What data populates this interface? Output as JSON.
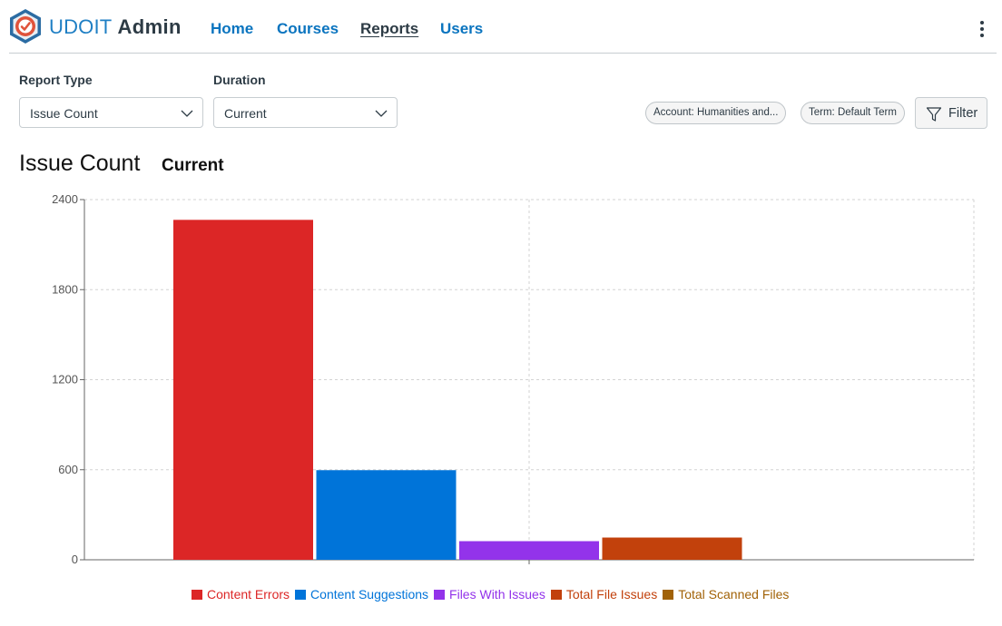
{
  "header": {
    "brand_name": "UDOIT",
    "brand_suffix": "Admin",
    "nav": [
      {
        "label": "Home",
        "active": false
      },
      {
        "label": "Courses",
        "active": false
      },
      {
        "label": "Reports",
        "active": true
      },
      {
        "label": "Users",
        "active": false
      }
    ],
    "menu_icon": "vertical-ellipsis-icon"
  },
  "filters": {
    "report_type_label": "Report Type",
    "report_type_value": "Issue Count",
    "duration_label": "Duration",
    "duration_value": "Current",
    "pills": [
      {
        "label": "Account: Humanities and..."
      },
      {
        "label": "Term: Default Term"
      }
    ],
    "filter_button_label": "Filter"
  },
  "report": {
    "title": "Issue Count",
    "subtitle": "Current"
  },
  "colors": {
    "accent": "#0a74bf",
    "text": "#2d3b45"
  },
  "chart_data": {
    "type": "bar",
    "ylim": [
      0,
      2400
    ],
    "yticks": [
      "0",
      "600",
      "1200",
      "1800",
      "2400"
    ],
    "grid": true,
    "legend_position": "bottom",
    "series": [
      {
        "name": "Content Errors",
        "value": 2265,
        "color": "#dc2626"
      },
      {
        "name": "Content Suggestions",
        "value": 597,
        "color": "#0074d9"
      },
      {
        "name": "Files With Issues",
        "value": 124,
        "color": "#9333ea"
      },
      {
        "name": "Total File Issues",
        "value": 148,
        "color": "#c2410c"
      },
      {
        "name": "Total Scanned Files",
        "value": 0,
        "color": "#a16207"
      }
    ]
  }
}
